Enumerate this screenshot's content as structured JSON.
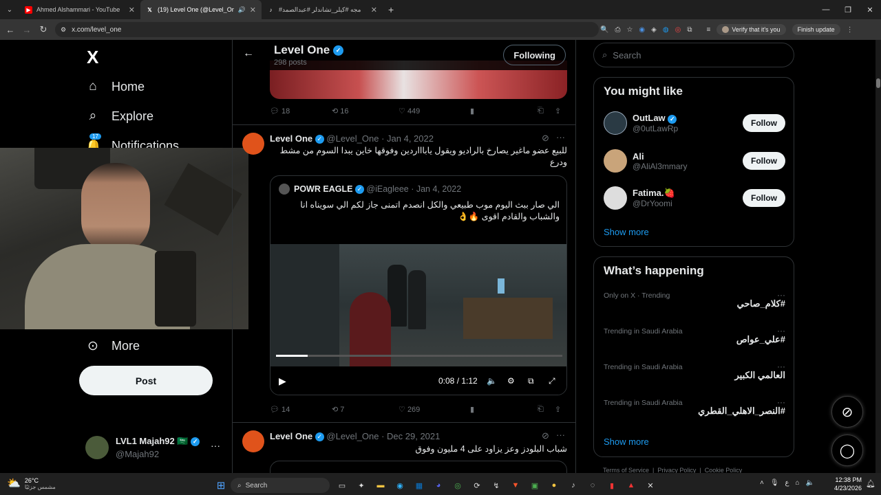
{
  "browser": {
    "tabs": [
      {
        "title": "Ahmed Alshammari - YouTube",
        "icon": "youtube-icon",
        "color": "#ff0000"
      },
      {
        "title": "(19) Level One (@Level_One",
        "icon": "x-icon",
        "color": "#ffffff"
      },
      {
        "title": "#مجه #كيلر_تشاندلر #عبدالصمد",
        "icon": "tiktok-icon",
        "color": "#ffffff"
      }
    ],
    "url": "x.com/level_one",
    "verify_label": "Verify that it's you",
    "finish_update": "Finish update"
  },
  "sidebar": {
    "logo": "X",
    "items": [
      {
        "label": "Home",
        "icon": "home-icon"
      },
      {
        "label": "Explore",
        "icon": "search-icon"
      },
      {
        "label": "Notifications",
        "icon": "bell-icon",
        "badge": "17"
      },
      {
        "label": "More",
        "icon": "more-circle-icon"
      }
    ],
    "post_label": "Post",
    "account": {
      "name": "LVL1 Majah92",
      "flag": "🇸🇦",
      "handle": "@Majah92"
    }
  },
  "header": {
    "name": "Level One",
    "posts": "298 posts",
    "following_label": "Following"
  },
  "feed": {
    "prev_actions": {
      "replies": "18",
      "reposts": "16",
      "likes": "449"
    },
    "tweet1": {
      "name": "Level One",
      "handle": "@Level_One",
      "date": "· Jan 4, 2022",
      "text": "للبيع عضو ماغير يصارخ بالراديو ويقول ياباااردين وفوقها خاين يبدا السوم من مشط ودرع",
      "quote": {
        "name": "POWR EAGLE",
        "handle": "@iEagleee",
        "date": "· Jan 4, 2022",
        "text": "الي صار ببث اليوم موب طبيعي والكل انصدم اتمنى جاز لكم الي سويناه انا والشباب والقادم اقوى 🔥👌"
      },
      "video": {
        "time": "0:08 / 1:12",
        "progress": 0.11
      },
      "actions": {
        "replies": "14",
        "reposts": "7",
        "likes": "269"
      }
    },
    "tweet2": {
      "name": "Level One",
      "handle": "@Level_One",
      "date": "· Dec 29, 2021",
      "text": "شباب البلودز وعز يزاود على 4 مليون وفوق"
    }
  },
  "right": {
    "search_placeholder": "Search",
    "might_like": {
      "title": "You might like",
      "users": [
        {
          "name": "OutLaw",
          "handle": "@0utLawRp",
          "verified": true
        },
        {
          "name": "Ali",
          "handle": "@AliAl3mmary",
          "verified": false
        },
        {
          "name": "Fatima.🍓",
          "handle": "@DrYoomi",
          "verified": false
        }
      ],
      "follow_label": "Follow",
      "show_more": "Show more"
    },
    "happening": {
      "title": "What’s happening",
      "trends": [
        {
          "category": "Only on X · Trending",
          "name": "#كلام_صاحي"
        },
        {
          "category": "Trending in Saudi Arabia",
          "name": "#علي_عواص"
        },
        {
          "category": "Trending in Saudi Arabia",
          "name": "العالمي الكبير"
        },
        {
          "category": "Trending in Saudi Arabia",
          "name": "#النصر_الاهلي_القطري"
        }
      ],
      "show_more": "Show more"
    },
    "footer": "Terms of Service  |  Privacy Policy  |  Cookie Policy"
  },
  "taskbar": {
    "weather_temp": "26°C",
    "weather_desc": "مشمس جزئيًا",
    "search": "Search",
    "time": "12:38 PM",
    "date": "4/23/2026",
    "lang": "ع"
  }
}
